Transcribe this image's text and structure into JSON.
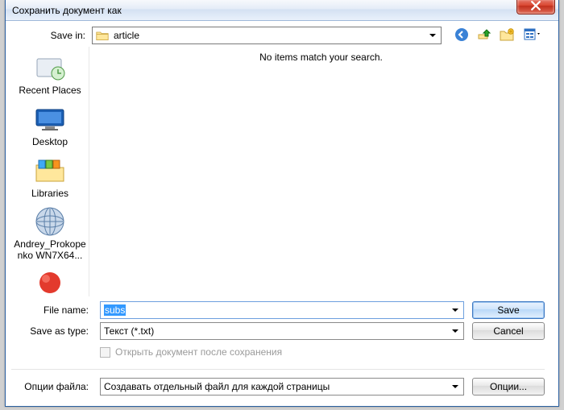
{
  "window": {
    "title": "Сохранить документ как"
  },
  "savein": {
    "label": "Save in:",
    "value": "article"
  },
  "listing": {
    "empty_message": "No items match your search."
  },
  "places": [
    {
      "id": "recent",
      "label": "Recent Places"
    },
    {
      "id": "desktop",
      "label": "Desktop"
    },
    {
      "id": "libraries",
      "label": "Libraries"
    },
    {
      "id": "computer",
      "label": "Andrey_Prokopenko WN7X64..."
    },
    {
      "id": "network",
      "label": ""
    }
  ],
  "filename": {
    "label": "File name:",
    "value": "subs"
  },
  "savetype": {
    "label": "Save as type:",
    "value": "Текст (*.txt)"
  },
  "open_after": {
    "label": "Открыть документ после сохранения"
  },
  "file_options": {
    "label": "Опции файла:",
    "value": "Создавать отдельный файл для каждой страницы"
  },
  "buttons": {
    "save": "Save",
    "cancel": "Cancel",
    "options": "Опции..."
  }
}
